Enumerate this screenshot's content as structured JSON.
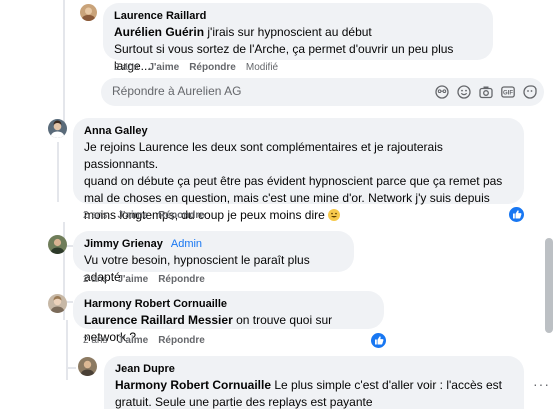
{
  "comments": [
    {
      "author": "Laurence Raillard",
      "mention": "Aurélien Guérin",
      "line1": " j'irais sur hypnoscient au début",
      "line2": "Surtout si vous sortez de l'Arche, ça permet d'ouvrir un peu plus large...",
      "time": "2 ans",
      "like": "J'aime",
      "reply": "Répondre",
      "edited": "Modifié"
    },
    {
      "author": "Anna Galley",
      "lines": [
        "Je rejoins Laurence les deux sont complémentaires et je rajouterais passionnants.",
        "quand on débute ça peut être pas évident hypnoscient parce que ça remet pas",
        "mal de choses en question, mais c'est une mine d'or. Network j'y suis depuis",
        "moins longtemps, du coup je peux moins dire"
      ],
      "time": "2 ans",
      "like": "J'aime",
      "reply": "Répondre"
    },
    {
      "author": "Jimmy Grienay",
      "badge": "Admin",
      "text": "Vu votre besoin, hypnoscient le paraît plus adapté",
      "time": "2 ans",
      "like": "J'aime",
      "reply": "Répondre"
    },
    {
      "author": "Harmony Robert Cornuaille",
      "mention": "Laurence Raillard Messier",
      "text": " on trouve quoi sur network ?",
      "time": "2 ans",
      "like": "J'aime",
      "reply": "Répondre"
    },
    {
      "author": "Jean Dupre",
      "mention": "Harmony Robert Cornuaille",
      "line1": " Le plus simple c'est d'aller voir : l'accès est",
      "line2": "gratuit. Seule une partie des replays est payante"
    }
  ],
  "reply_box": {
    "placeholder": "Répondre à Aurelien AG"
  },
  "reply_tools": [
    "sticker-icon",
    "emoji-icon",
    "camera-icon",
    "gif-icon",
    "avatar-sticker-icon"
  ],
  "more_menu": "···",
  "colors": {
    "bubble": "#f0f2f5",
    "like_blue": "#1877f2",
    "meta_grey": "#65676b"
  }
}
